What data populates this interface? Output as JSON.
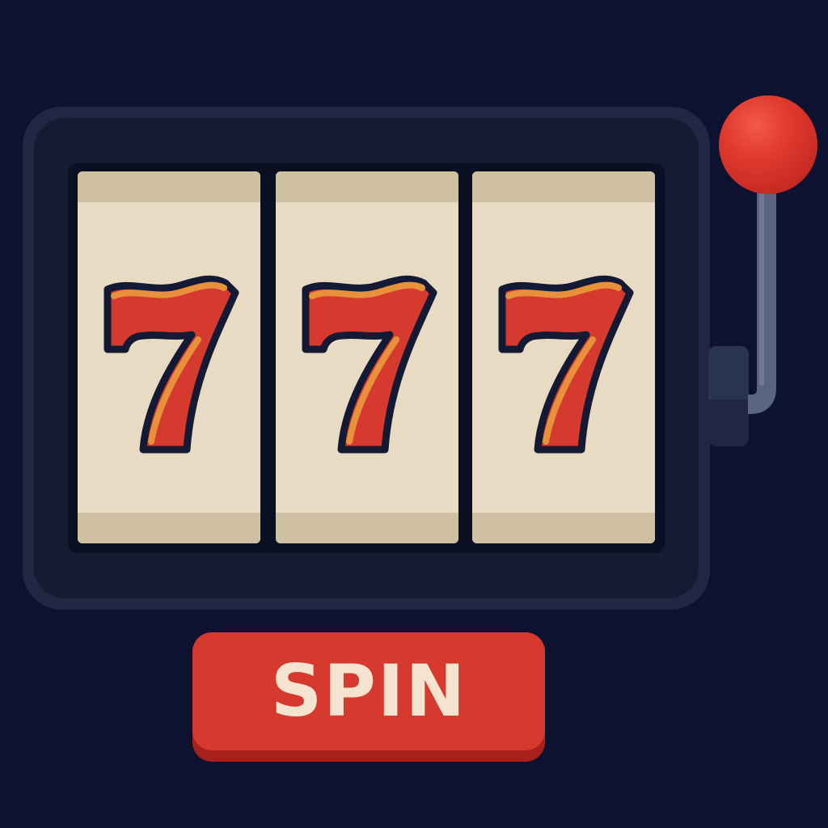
{
  "machine": {
    "reels": [
      {
        "symbol": "seven-icon"
      },
      {
        "symbol": "seven-icon"
      },
      {
        "symbol": "seven-icon"
      }
    ],
    "lever_icon": "lever-icon"
  },
  "controls": {
    "spin_label": "SPIN"
  },
  "colors": {
    "background": "#0d1230",
    "cabinet": "#1f2743",
    "reel_face": "#e8dbc4",
    "seven_red": "#d63a2e",
    "seven_highlight": "#e8913a",
    "button_red": "#d63a2e",
    "knob_red": "#e23a2f"
  }
}
